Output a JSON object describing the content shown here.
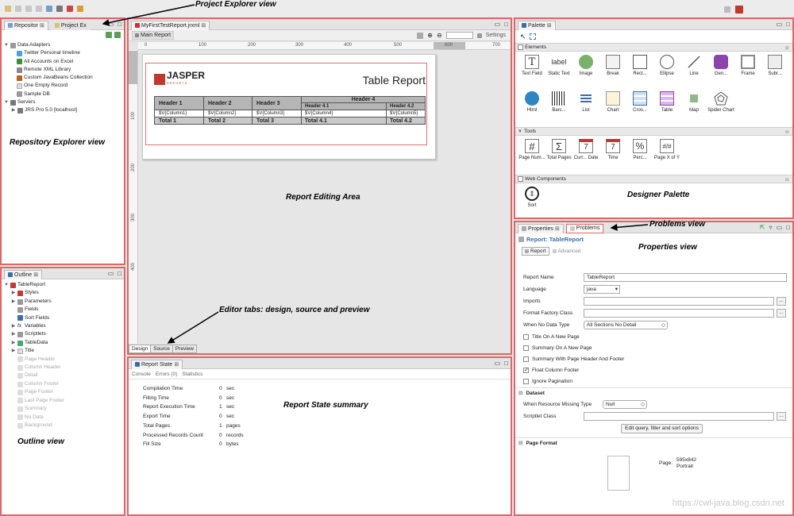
{
  "annotations": {
    "project_explorer": "Project Explorer view",
    "repository_explorer": "Repository Explorer view",
    "outline": "Outline view",
    "report_editing": "Report Editing Area",
    "editor_tabs": "Editor tabs: design, source and preview",
    "report_state_summary": "Report State summary",
    "designer_palette": "Designer Palette",
    "problems": "Problems view",
    "properties": "Properties view"
  },
  "repository": {
    "tab_label": "Repositor",
    "project_tab_label": "Project Ex",
    "items": [
      {
        "label": "Data Adapters"
      },
      {
        "label": "Twitter Personal timeline"
      },
      {
        "label": "All Accounts on Excel"
      },
      {
        "label": "Remote XML Library"
      },
      {
        "label": "Custom JavaBeans Collection"
      },
      {
        "label": "One Empty Record"
      },
      {
        "label": "Sample DB"
      },
      {
        "label": "Servers"
      },
      {
        "label": "JRS Pro 5.0 [localhost]"
      }
    ]
  },
  "outline": {
    "tab_label": "Outline",
    "items": [
      {
        "label": "TableReport"
      },
      {
        "label": "Styles"
      },
      {
        "label": "Parameters"
      },
      {
        "label": "Fields"
      },
      {
        "label": "Sort Fields"
      },
      {
        "label": "Variables"
      },
      {
        "label": "Scriptlets"
      },
      {
        "label": "TableData"
      },
      {
        "label": "Title"
      },
      {
        "label": "Page Header"
      },
      {
        "label": "Column Header"
      },
      {
        "label": "Detail"
      },
      {
        "label": "Column Footer"
      },
      {
        "label": "Page Footer"
      },
      {
        "label": "Last Page Footer"
      },
      {
        "label": "Summary"
      },
      {
        "label": "No Data"
      },
      {
        "label": "Background"
      }
    ]
  },
  "editor": {
    "file_tab": "MyFirstTestReport.jrxml",
    "main_report": "Main Report",
    "settings": "Settings",
    "ruler_h": [
      "0",
      "100",
      "200",
      "300",
      "400",
      "500",
      "600",
      "700"
    ],
    "ruler_v": [
      "100",
      "200",
      "300",
      "400"
    ],
    "logo_text": "JASPER",
    "logo_sub": "REPORTS",
    "report_title": "Table Report",
    "header4": "Header 4",
    "headers": [
      "Header 1",
      "Header 2",
      "Header 3",
      "Header 4.1",
      "Header 4.2"
    ],
    "cells": [
      "$V{Column1}",
      "$V{Column2}",
      "$V{Column3}",
      "$V{Column4}",
      "$V{Column5}"
    ],
    "totals": [
      "Total 1",
      "Total 2",
      "Total 3",
      "Total 4.1",
      "Total 4.2"
    ],
    "bottom_tabs": [
      "Design",
      "Source",
      "Preview"
    ]
  },
  "report_state": {
    "tab_label": "Report State",
    "subtabs": [
      "Console",
      "Errors (0)",
      "Statistics"
    ],
    "rows": [
      {
        "label": "Compilation Time",
        "value": "0",
        "unit": "sec"
      },
      {
        "label": "Filling Time",
        "value": "0",
        "unit": "sec"
      },
      {
        "label": "Report Execution Time",
        "value": "1",
        "unit": "sec"
      },
      {
        "label": "Export Time",
        "value": "0",
        "unit": "sec"
      },
      {
        "label": "Total Pages",
        "value": "1",
        "unit": "pages"
      },
      {
        "label": "Processed Records Count",
        "value": "0",
        "unit": "records"
      },
      {
        "label": "Fill Size",
        "value": "0",
        "unit": "bytes"
      }
    ]
  },
  "palette": {
    "tab_label": "Palette",
    "elements_header": "Elements",
    "elements": [
      {
        "label": "Text Field",
        "icon": "T"
      },
      {
        "label": "Static Text",
        "icon": "label"
      },
      {
        "label": "Image",
        "icon": "img"
      },
      {
        "label": "Break",
        "icon": "brk"
      },
      {
        "label": "Rect...",
        "icon": "rect"
      },
      {
        "label": "Ellipse",
        "icon": "ell"
      },
      {
        "label": "Line",
        "icon": "line"
      },
      {
        "label": "Gen...",
        "icon": "gen"
      },
      {
        "label": "Frame",
        "icon": "frame"
      },
      {
        "label": "Subr...",
        "icon": "sub"
      },
      {
        "label": "Html",
        "icon": "html"
      },
      {
        "label": "Barc...",
        "icon": "bar"
      },
      {
        "label": "List",
        "icon": "list"
      },
      {
        "label": "Chart",
        "icon": "chart"
      },
      {
        "label": "Cros...",
        "icon": "cross"
      },
      {
        "label": "Table",
        "icon": "table"
      },
      {
        "label": "Map",
        "icon": "map"
      },
      {
        "label": "Spider Chart",
        "icon": "spider"
      }
    ],
    "tools_header": "Tools",
    "tools": [
      {
        "label": "Page Num...",
        "icon": "#"
      },
      {
        "label": "Total Pages",
        "icon": "Σ"
      },
      {
        "label": "Curr... Date",
        "icon": "7"
      },
      {
        "label": "Time",
        "icon": "7"
      },
      {
        "label": "Perc...",
        "icon": "%"
      },
      {
        "label": "Page X of Y",
        "icon": "#/#"
      }
    ],
    "web_header": "Web Components",
    "web": [
      {
        "label": "Sort",
        "icon": "sort"
      }
    ]
  },
  "properties": {
    "tab_label": "Properties",
    "problems_tab": "Problems",
    "title": "Report: TableReport",
    "subtab_report": "Report",
    "subtab_advanced": "Advanced",
    "report_name_label": "Report Name",
    "report_name_value": "TableReport",
    "language_label": "Language",
    "language_value": "java",
    "imports_label": "Imports",
    "format_factory_label": "Format Factory Class",
    "when_no_data_label": "When No Data Type",
    "when_no_data_value": "All Sections No Detail",
    "checks": [
      {
        "label": "Title On A New Page",
        "checked": false
      },
      {
        "label": "Summary On A New Page",
        "checked": false
      },
      {
        "label": "Summary With Page Header And Footer",
        "checked": false
      },
      {
        "label": "Float Column Footer",
        "checked": true
      },
      {
        "label": "Ignore Pagination",
        "checked": false
      }
    ],
    "dataset_header": "Dataset",
    "when_missing_label": "When Resource Missing Type",
    "when_missing_value": "Null",
    "scriptlet_label": "Scriptlet Class",
    "edit_query_button": "Edit query, filter and sort options",
    "page_format_header": "Page Format",
    "page_label": "Page:",
    "page_size": "595x842",
    "page_orientation": "Portrait"
  },
  "watermark": "https://cwl-java.blog.csdn.net",
  "colors": {
    "highlight": "#e06666",
    "accent_blue": "#3b6ea5"
  }
}
